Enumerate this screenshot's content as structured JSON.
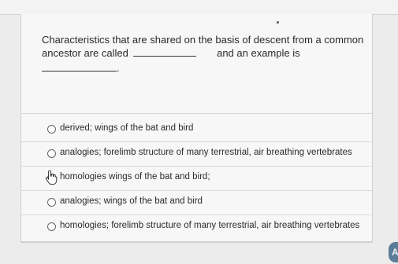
{
  "question": {
    "line1": "Characteristics that are shared on the basis of descent from a common",
    "line2_start": "ancestor are called",
    "line2_middle": "and an example is",
    "line3_end": "."
  },
  "options": [
    {
      "label": "derived; wings of the bat and bird",
      "selected": false
    },
    {
      "label": "analogies; forelimb structure of many terrestrial, air breathing vertebrates",
      "selected": false
    },
    {
      "label": "homologies wings of the bat and bird;",
      "selected": false
    },
    {
      "label": "analogies; wings of the bat and bird",
      "selected": false
    },
    {
      "label": "homologies; forelimb structure of many terrestrial, air breathing vertebrates",
      "selected": false
    }
  ],
  "cursor": {
    "icon": "hand-pointer-icon"
  },
  "badge": {
    "text": "A",
    "color": "#5a7d9a"
  }
}
